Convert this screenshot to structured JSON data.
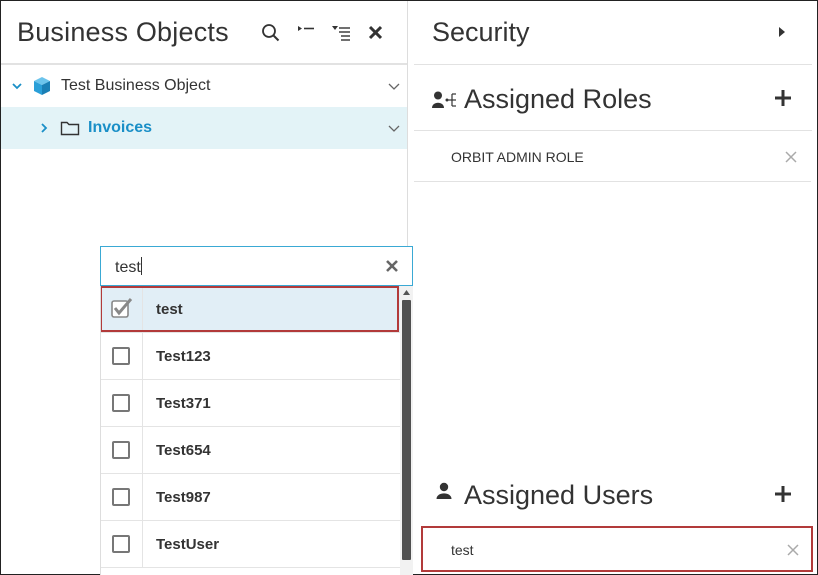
{
  "business_objects": {
    "title": "Business Objects",
    "icons": [
      "search-icon",
      "collapse-all-icon",
      "expand-all-icon",
      "close-icon"
    ],
    "tree": [
      {
        "label": "Test Business Object",
        "icon": "cube-icon",
        "expanded": true
      },
      {
        "label": "Invoices",
        "icon": "folder-icon",
        "expanded": false,
        "highlighted": true
      }
    ],
    "colors": {
      "tree_selected_bg": "#e3f3f7",
      "link": "#1a8fc7",
      "cube": "#2a9fd8"
    }
  },
  "dropdown": {
    "search_value": "test",
    "items": [
      {
        "label": "test",
        "checked": true
      },
      {
        "label": "Test123",
        "checked": false
      },
      {
        "label": "Test371",
        "checked": false
      },
      {
        "label": "Test654",
        "checked": false
      },
      {
        "label": "Test987",
        "checked": false
      },
      {
        "label": "TestUser",
        "checked": false
      }
    ],
    "colors": {
      "focus_border": "#3aa9d4",
      "highlight_border": "#b23a3a",
      "selected_bg": "#e1eef6"
    }
  },
  "security": {
    "title": "Security",
    "roles": {
      "title": "Assigned Roles",
      "icon": "user-roles-icon",
      "items": [
        "ORBIT ADMIN ROLE"
      ]
    },
    "users": {
      "title": "Assigned Users",
      "icon": "user-icon",
      "items": [
        "test"
      ]
    }
  }
}
